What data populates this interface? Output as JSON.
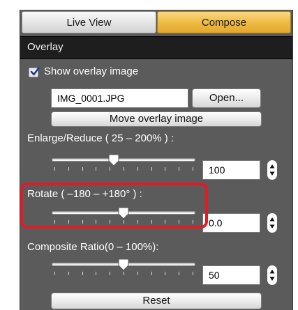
{
  "tabs": [
    {
      "label": "Live View"
    },
    {
      "label": "Compose"
    }
  ],
  "section": {
    "title": "Overlay"
  },
  "overlay": {
    "show_label": "Show overlay image",
    "show_checked": true,
    "file_value": "IMG_0001.JPG",
    "open_label": "Open...",
    "move_label": "Move overlay image"
  },
  "enlarge": {
    "label": "Enlarge/Reduce ( 25 – 200% ) :",
    "value": "100",
    "min": 25,
    "max": 200,
    "current": 100
  },
  "rotate": {
    "label": "Rotate ( –180 – +180° ) :",
    "value": "0.0",
    "min": -180,
    "max": 180,
    "current": 0
  },
  "composite": {
    "label": "Composite Ratio(0 – 100%):",
    "value": "50",
    "min": 0,
    "max": 100,
    "current": 50
  },
  "reset_label": "Reset",
  "colors": {
    "accent": "#efbf4a",
    "highlight": "#e11b26",
    "panel": "#5b5b5b"
  },
  "icons": [
    "checkmark-icon",
    "slider-thumb-icon",
    "stepper-arrows-icon"
  ]
}
